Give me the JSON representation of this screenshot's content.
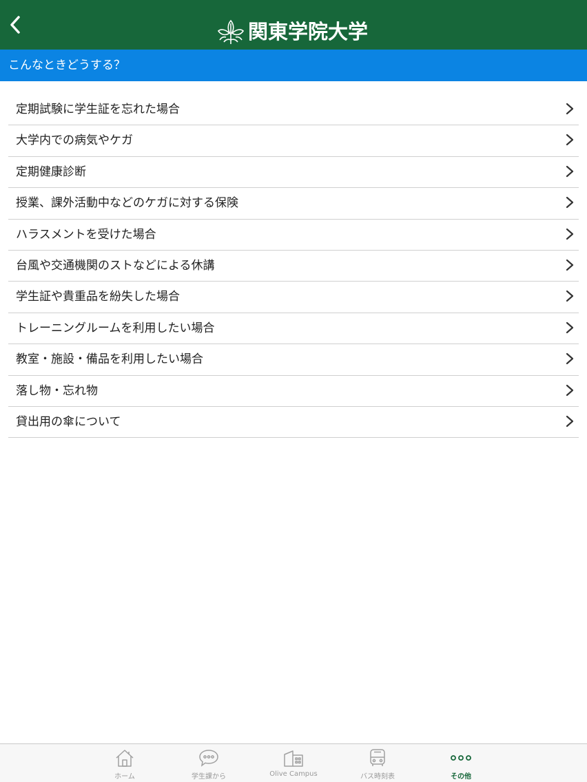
{
  "header": {
    "title": "関東学院大学",
    "logo_icon": "olive-leaf-logo-icon",
    "back_icon": "chevron-left-icon",
    "background_color": "#17673a"
  },
  "section": {
    "title": "こんなときどうする？",
    "background_color": "#0b84e3"
  },
  "menu": {
    "chevron_icon": "chevron-right-icon",
    "items": [
      {
        "label": "定期試験に学生証を忘れた場合"
      },
      {
        "label": "大学内での病気やケガ"
      },
      {
        "label": "定期健康診断"
      },
      {
        "label": "授業、課外活動中などのケガに対する保険"
      },
      {
        "label": "ハラスメントを受けた場合"
      },
      {
        "label": "台風や交通機関のストなどによる休講"
      },
      {
        "label": "学生証や貴重品を紛失した場合"
      },
      {
        "label": "トレーニングルームを利用したい場合"
      },
      {
        "label": "教室・施設・備品を利用したい場合"
      },
      {
        "label": "落し物・忘れ物"
      },
      {
        "label": "貸出用の傘について"
      }
    ]
  },
  "tabbar": {
    "active_color": "#17673a",
    "inactive_color": "#999999",
    "tabs": [
      {
        "label": "ホーム",
        "icon": "home-icon",
        "active": false
      },
      {
        "label": "学生課から",
        "icon": "chat-bubble-icon",
        "active": false
      },
      {
        "label": "Olive Campus",
        "icon": "building-icon",
        "active": false
      },
      {
        "label": "バス時刻表",
        "icon": "bus-icon",
        "active": false
      },
      {
        "label": "その他",
        "icon": "more-dots-icon",
        "active": true
      }
    ]
  }
}
